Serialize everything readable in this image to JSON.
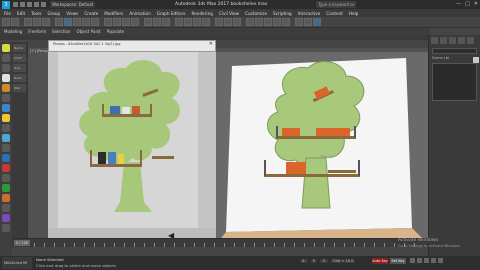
{
  "titlebar": {
    "app_title": "Autodesk 3ds Max 2017   bookshelve.max",
    "workspace": "Workspaces: Default",
    "search_placeholder": "Type a keyword or phrase",
    "min": "—",
    "max": "□",
    "close": "✕"
  },
  "menu": [
    "File",
    "Edit",
    "Tools",
    "Group",
    "Views",
    "Create",
    "Modifiers",
    "Animation",
    "Graph Editors",
    "Rendering",
    "Civil View",
    "Customize",
    "Scripting",
    "Interactive",
    "Content",
    "Help"
  ],
  "ribbon": {
    "tabs": [
      "Modeling",
      "Freeform",
      "Selection",
      "Object Paint",
      "Populate"
    ]
  },
  "viewport": {
    "label": "[+] [Perspective] [Standard] [Default Shading]"
  },
  "image_window": {
    "title": "Photos - 84cd0ee1b1d 3d1 1 3a(2).jpg",
    "close": "✕"
  },
  "scene_explorer": {
    "rows": [
      "Name",
      "Shelf",
      "Tree",
      "Book",
      "Wall"
    ]
  },
  "command_panel": {
    "label": "Scene Lbl"
  },
  "timeline": {
    "slider_text": "0 / 100"
  },
  "status": {
    "maxscript": "MAXScript Mi",
    "selected": "None Selected",
    "prompt": "Click and drag to select and move objects",
    "x": "X:",
    "y": "Y:",
    "z": "Z:",
    "grid": "Grid = 10.0",
    "autokey": "Auto Key",
    "setkey": "Set Key",
    "watermark_title": "Activate Windows",
    "watermark_sub": "Go to Settings to activate Windows."
  },
  "colors": {
    "tree_green": "#a8c87c",
    "photo_bg": "#c2c2c2",
    "scene_wall": "#f4f4f4",
    "floor": "#d8b48a",
    "shelf_wood": "#8a6a3c",
    "book_orange": "#d9652a"
  }
}
